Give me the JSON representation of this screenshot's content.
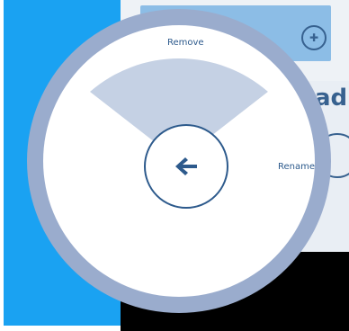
{
  "menu": {
    "items": [
      {
        "label": "Remove"
      },
      {
        "label": "Rename"
      }
    ],
    "center": {
      "icon": "back-arrow-icon"
    }
  },
  "colors": {
    "ring": "#9aaccd",
    "selected_sector": "#c5d1e4",
    "accent": "#2d5a8c",
    "background_blue": "#1aa2f2"
  }
}
